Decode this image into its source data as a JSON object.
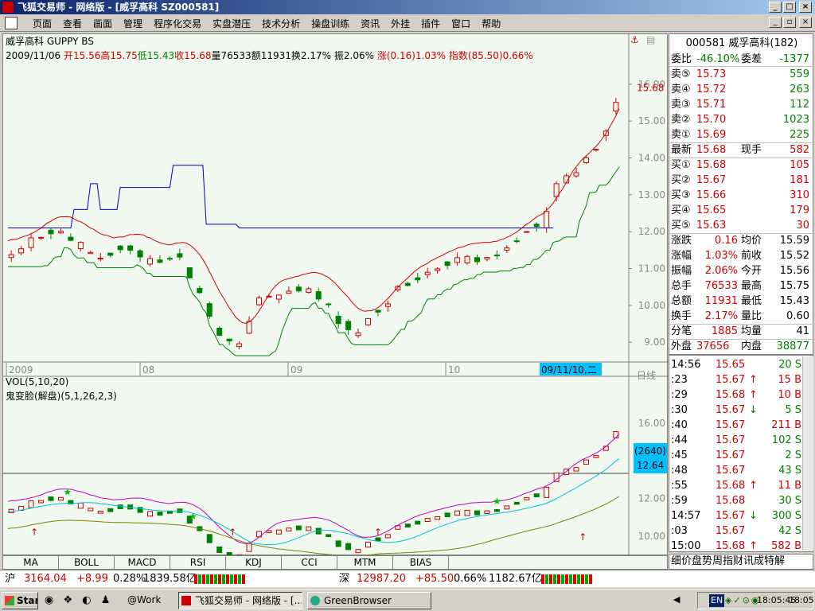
{
  "window": {
    "title": "飞狐交易师 - 网络版 - [威孚高科 SZ000581]",
    "min": "_",
    "max": "□",
    "close": "×",
    "child_min": "_",
    "child_restore": "▫",
    "child_close": "×"
  },
  "menu": [
    "页面",
    "查看",
    "画面",
    "管理",
    "程序化交易",
    "实盘潜压",
    "技术分析",
    "操盘训练",
    "资讯",
    "外挂",
    "插件",
    "窗口",
    "帮助"
  ],
  "main": {
    "title": "威孚高科 GUPPY BS",
    "ohlc": {
      "date": "2009/11/06",
      "open_label": "开",
      "open": "15.56",
      "high_label": "高",
      "high": "15.75",
      "low_label": "低",
      "low": "15.43",
      "close_label": "收",
      "close": "15.68",
      "vol_label": "量",
      "vol": "76533",
      "amt_label": "额",
      "amt": "11931",
      "turn_label": "换",
      "turn": "2.17%",
      "amp_label": "振",
      "amp": "2.06%",
      "chg_label": "涨",
      "chg": "(0.16)1.03%",
      "idx_label": "指数",
      "idx": "(85.50)0.66%"
    },
    "price_labels": [
      "16.00",
      "15.00",
      "14.00",
      "13.00",
      "12.00",
      "11.00",
      "10.00",
      "9.00"
    ],
    "current_price": "15.68",
    "date_axis": [
      "2009",
      "08",
      "09",
      "10"
    ],
    "date_highlight": "09/11/10,二",
    "period": "日线"
  },
  "sub": {
    "vol_title": "VOL(5,10,20)",
    "indicator_title": "鬼变脸(解盘)(5,1,26,2,3)",
    "labels": [
      "16.00",
      "12.00",
      "10.00"
    ],
    "value_box": [
      "(2640)",
      "12.64"
    ]
  },
  "tabs": [
    "MA",
    "BOLL",
    "MACD",
    "RSI",
    "KDJ",
    "CCI",
    "MTM",
    "BIAS"
  ],
  "quote": {
    "code": "000581 威孚高科(182)",
    "webi_label": "委比",
    "webi": "-46.10%",
    "wecha_label": "委差",
    "wecha": "-1377",
    "sells": [
      [
        "卖⑤",
        "15.73",
        "559"
      ],
      [
        "卖④",
        "15.72",
        "263"
      ],
      [
        "卖③",
        "15.71",
        "112"
      ],
      [
        "卖②",
        "15.70",
        "1023"
      ],
      [
        "卖①",
        "15.69",
        "225"
      ]
    ],
    "latest": [
      "最新",
      "15.68",
      "现手",
      "582"
    ],
    "buys": [
      [
        "买①",
        "15.68",
        "105"
      ],
      [
        "买②",
        "15.67",
        "181"
      ],
      [
        "买③",
        "15.66",
        "310"
      ],
      [
        "买④",
        "15.65",
        "179"
      ],
      [
        "买⑤",
        "15.63",
        "30"
      ]
    ],
    "stats": [
      [
        "涨跌",
        "0.16",
        "均价",
        "15.59"
      ],
      [
        "涨幅",
        "1.03%",
        "前收",
        "15.52"
      ],
      [
        "振幅",
        "2.06%",
        "今开",
        "15.56"
      ],
      [
        "总手",
        "76533",
        "最高",
        "15.75"
      ],
      [
        "总额",
        "11931",
        "最低",
        "15.43"
      ],
      [
        "换手",
        "2.17%",
        "量比",
        "0.60"
      ],
      [
        "分笔",
        "1885",
        "均量",
        "41"
      ]
    ],
    "outer": [
      "外盘",
      "37656",
      "内盘",
      "38877"
    ]
  },
  "trades": [
    [
      "14:56",
      "15.65",
      "",
      "20 S"
    ],
    [
      ":23",
      "15.67",
      "↑",
      "15 B"
    ],
    [
      ":29",
      "15.68",
      "↑",
      "10 B"
    ],
    [
      ":30",
      "15.67",
      "↓",
      "5 S"
    ],
    [
      ":40",
      "15.67",
      "",
      "211 B"
    ],
    [
      ":44",
      "15.67",
      "",
      "102 S"
    ],
    [
      ":45",
      "15.67",
      "",
      "2 S"
    ],
    [
      ":48",
      "15.67",
      "",
      "43 S"
    ],
    [
      ":55",
      "15.68",
      "↑",
      "11 B"
    ],
    [
      ":59",
      "15.68",
      "",
      "30 S"
    ],
    [
      "14:57",
      "15.67",
      "↓",
      "300 S"
    ],
    [
      ":03",
      "15.67",
      "",
      "42 S"
    ],
    [
      "15:00",
      "15.68",
      "↑",
      "582 B"
    ]
  ],
  "bottom_strip": "细价盘势周指财讯成特解",
  "status": {
    "sh_label": "沪",
    "sh": "3164.04",
    "sh_chg": "+8.99",
    "sh_pct": "0.28%",
    "sh_amt": "1839.58亿",
    "sz_label": "深",
    "sz": "12987.20",
    "sz_chg": "+85.50",
    "sz_pct": "0.66%",
    "sz_amt": "1182.67亿"
  },
  "taskbar": {
    "start": "Start",
    "work": "@Work",
    "task1": "飞狐交易师 - 网络版 - [...",
    "task2": "GreenBrowser",
    "lang": "EN",
    "time_a": "18:05:45",
    "time_b": "18:05"
  },
  "chart_data": {
    "type": "candlestick",
    "x": [
      "2009-07",
      "2009-08",
      "2009-09",
      "2009-10",
      "2009-11"
    ],
    "ylim": [
      8.4,
      16.6
    ],
    "last": {
      "open": 15.56,
      "high": 15.75,
      "low": 15.43,
      "close": 15.68
    },
    "indicators": {
      "guppy_upper_line": "blue",
      "guppy_mid_line": "red",
      "guppy_lower_line": "green"
    }
  }
}
